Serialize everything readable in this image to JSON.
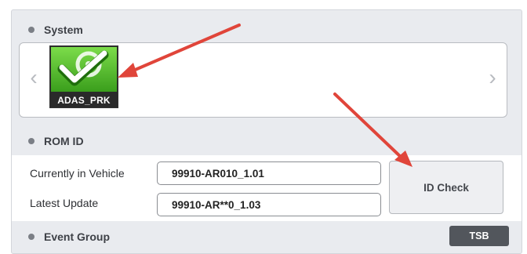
{
  "system": {
    "title": "System",
    "prev_icon": "chevron-left-icon",
    "next_icon": "chevron-right-icon",
    "tiles": [
      {
        "label": "ADAS_PRK",
        "icon": "adas-prk-checkmark-icon"
      }
    ]
  },
  "rom_id": {
    "title": "ROM ID",
    "rows": [
      {
        "label": "Currently in Vehicle",
        "value": "99910-AR010_1.01"
      },
      {
        "label": "Latest Update",
        "value": "99910-AR**0_1.03"
      }
    ],
    "id_check_label": "ID Check"
  },
  "event_group": {
    "title": "Event Group",
    "tsb_label": "TSB"
  },
  "colors": {
    "annotation_arrow": "#e0453a",
    "tile_green": "#4cb52a",
    "section_bg": "#e9ebef"
  }
}
